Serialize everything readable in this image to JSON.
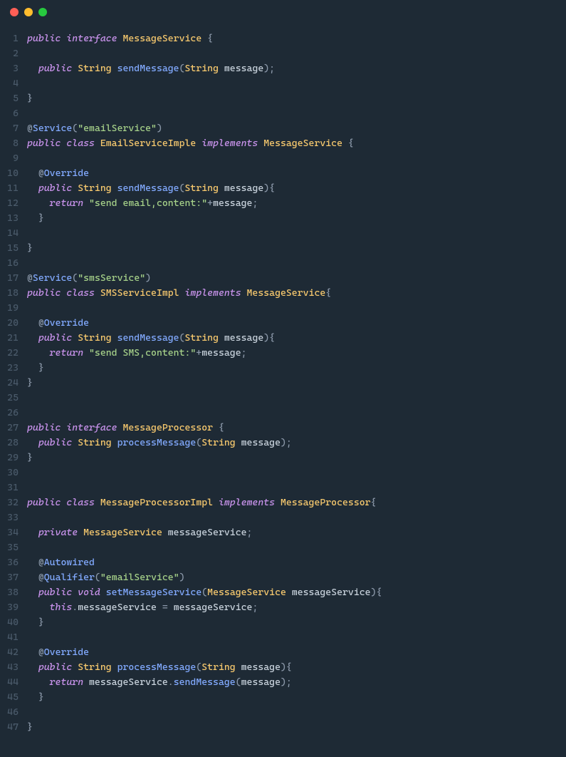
{
  "titlebar": {
    "dots": [
      "red",
      "yellow",
      "green"
    ]
  },
  "code": {
    "lines": [
      [
        {
          "t": "public ",
          "c": "kw"
        },
        {
          "t": "interface ",
          "c": "kw"
        },
        {
          "t": "MessageService",
          "c": "type"
        },
        {
          "t": " {",
          "c": "punct"
        }
      ],
      [],
      [
        {
          "t": "  ",
          "c": ""
        },
        {
          "t": "public ",
          "c": "kw"
        },
        {
          "t": "String ",
          "c": "type"
        },
        {
          "t": "sendMessage",
          "c": "fn"
        },
        {
          "t": "(",
          "c": "punct"
        },
        {
          "t": "String ",
          "c": "type"
        },
        {
          "t": "message",
          "c": "ident"
        },
        {
          "t": ");",
          "c": "punct"
        }
      ],
      [],
      [
        {
          "t": "}",
          "c": "punct"
        }
      ],
      [],
      [
        {
          "t": "@",
          "c": "punct"
        },
        {
          "t": "Service",
          "c": "annName"
        },
        {
          "t": "(",
          "c": "punct"
        },
        {
          "t": "\"emailService\"",
          "c": "str"
        },
        {
          "t": ")",
          "c": "punct"
        }
      ],
      [
        {
          "t": "public ",
          "c": "kw"
        },
        {
          "t": "class ",
          "c": "kw"
        },
        {
          "t": "EmailServiceImple ",
          "c": "type"
        },
        {
          "t": "implements ",
          "c": "kw"
        },
        {
          "t": "MessageService",
          "c": "type"
        },
        {
          "t": " {",
          "c": "punct"
        }
      ],
      [],
      [
        {
          "t": "  ",
          "c": ""
        },
        {
          "t": "@",
          "c": "punct"
        },
        {
          "t": "Override",
          "c": "annName"
        }
      ],
      [
        {
          "t": "  ",
          "c": ""
        },
        {
          "t": "public ",
          "c": "kw"
        },
        {
          "t": "String ",
          "c": "type"
        },
        {
          "t": "sendMessage",
          "c": "fn"
        },
        {
          "t": "(",
          "c": "punct"
        },
        {
          "t": "String ",
          "c": "type"
        },
        {
          "t": "message",
          "c": "ident"
        },
        {
          "t": "){",
          "c": "punct"
        }
      ],
      [
        {
          "t": "    ",
          "c": ""
        },
        {
          "t": "return ",
          "c": "kw"
        },
        {
          "t": "\"send email,content:\"",
          "c": "str"
        },
        {
          "t": "+",
          "c": "punct"
        },
        {
          "t": "message",
          "c": "ident"
        },
        {
          "t": ";",
          "c": "punct"
        }
      ],
      [
        {
          "t": "  ",
          "c": ""
        },
        {
          "t": "}",
          "c": "punct"
        }
      ],
      [],
      [
        {
          "t": "}",
          "c": "punct"
        }
      ],
      [],
      [
        {
          "t": "@",
          "c": "punct"
        },
        {
          "t": "Service",
          "c": "annName"
        },
        {
          "t": "(",
          "c": "punct"
        },
        {
          "t": "\"smsService\"",
          "c": "str"
        },
        {
          "t": ")",
          "c": "punct"
        }
      ],
      [
        {
          "t": "public ",
          "c": "kw"
        },
        {
          "t": "class ",
          "c": "kw"
        },
        {
          "t": "SMSServiceImpl ",
          "c": "type"
        },
        {
          "t": "implements ",
          "c": "kw"
        },
        {
          "t": "MessageService",
          "c": "type"
        },
        {
          "t": "{",
          "c": "punct"
        }
      ],
      [],
      [
        {
          "t": "  ",
          "c": ""
        },
        {
          "t": "@",
          "c": "punct"
        },
        {
          "t": "Override",
          "c": "annName"
        }
      ],
      [
        {
          "t": "  ",
          "c": ""
        },
        {
          "t": "public ",
          "c": "kw"
        },
        {
          "t": "String ",
          "c": "type"
        },
        {
          "t": "sendMessage",
          "c": "fn"
        },
        {
          "t": "(",
          "c": "punct"
        },
        {
          "t": "String ",
          "c": "type"
        },
        {
          "t": "message",
          "c": "ident"
        },
        {
          "t": "){",
          "c": "punct"
        }
      ],
      [
        {
          "t": "    ",
          "c": ""
        },
        {
          "t": "return ",
          "c": "kw"
        },
        {
          "t": "\"send SMS,content:\"",
          "c": "str"
        },
        {
          "t": "+",
          "c": "punct"
        },
        {
          "t": "message",
          "c": "ident"
        },
        {
          "t": ";",
          "c": "punct"
        }
      ],
      [
        {
          "t": "  ",
          "c": ""
        },
        {
          "t": "}",
          "c": "punct"
        }
      ],
      [
        {
          "t": "}",
          "c": "punct"
        }
      ],
      [],
      [],
      [
        {
          "t": "public ",
          "c": "kw"
        },
        {
          "t": "interface ",
          "c": "kw"
        },
        {
          "t": "MessageProcessor",
          "c": "type"
        },
        {
          "t": " {",
          "c": "punct"
        }
      ],
      [
        {
          "t": "  ",
          "c": ""
        },
        {
          "t": "public ",
          "c": "kw"
        },
        {
          "t": "String ",
          "c": "type"
        },
        {
          "t": "processMessage",
          "c": "fn"
        },
        {
          "t": "(",
          "c": "punct"
        },
        {
          "t": "String ",
          "c": "type"
        },
        {
          "t": "message",
          "c": "ident"
        },
        {
          "t": ");",
          "c": "punct"
        }
      ],
      [
        {
          "t": "}",
          "c": "punct"
        }
      ],
      [],
      [],
      [
        {
          "t": "public ",
          "c": "kw"
        },
        {
          "t": "class ",
          "c": "kw"
        },
        {
          "t": "MessageProcessorImpl ",
          "c": "type"
        },
        {
          "t": "implements ",
          "c": "kw"
        },
        {
          "t": "MessageProcessor",
          "c": "type"
        },
        {
          "t": "{",
          "c": "punct"
        }
      ],
      [],
      [
        {
          "t": "  ",
          "c": ""
        },
        {
          "t": "private ",
          "c": "kw"
        },
        {
          "t": "MessageService ",
          "c": "type"
        },
        {
          "t": "messageService",
          "c": "ident"
        },
        {
          "t": ";",
          "c": "punct"
        }
      ],
      [],
      [
        {
          "t": "  ",
          "c": ""
        },
        {
          "t": "@",
          "c": "punct"
        },
        {
          "t": "Autowired",
          "c": "annName"
        }
      ],
      [
        {
          "t": "  ",
          "c": ""
        },
        {
          "t": "@",
          "c": "punct"
        },
        {
          "t": "Qualifier",
          "c": "annName"
        },
        {
          "t": "(",
          "c": "punct"
        },
        {
          "t": "\"emailService\"",
          "c": "str"
        },
        {
          "t": ")",
          "c": "punct"
        }
      ],
      [
        {
          "t": "  ",
          "c": ""
        },
        {
          "t": "public ",
          "c": "kw"
        },
        {
          "t": "void ",
          "c": "kw"
        },
        {
          "t": "setMessageService",
          "c": "fn"
        },
        {
          "t": "(",
          "c": "punct"
        },
        {
          "t": "MessageService ",
          "c": "type"
        },
        {
          "t": "messageService",
          "c": "ident"
        },
        {
          "t": "){",
          "c": "punct"
        }
      ],
      [
        {
          "t": "    ",
          "c": ""
        },
        {
          "t": "this",
          "c": "kw"
        },
        {
          "t": ".",
          "c": "punct"
        },
        {
          "t": "messageService",
          "c": "ident"
        },
        {
          "t": " = ",
          "c": "punct"
        },
        {
          "t": "messageService",
          "c": "ident"
        },
        {
          "t": ";",
          "c": "punct"
        }
      ],
      [
        {
          "t": "  ",
          "c": ""
        },
        {
          "t": "}",
          "c": "punct"
        }
      ],
      [],
      [
        {
          "t": "  ",
          "c": ""
        },
        {
          "t": "@",
          "c": "punct"
        },
        {
          "t": "Override",
          "c": "annName"
        }
      ],
      [
        {
          "t": "  ",
          "c": ""
        },
        {
          "t": "public ",
          "c": "kw"
        },
        {
          "t": "String ",
          "c": "type"
        },
        {
          "t": "processMessage",
          "c": "fn"
        },
        {
          "t": "(",
          "c": "punct"
        },
        {
          "t": "String ",
          "c": "type"
        },
        {
          "t": "message",
          "c": "ident"
        },
        {
          "t": "){",
          "c": "punct"
        }
      ],
      [
        {
          "t": "    ",
          "c": ""
        },
        {
          "t": "return ",
          "c": "kw"
        },
        {
          "t": "messageService",
          "c": "ident"
        },
        {
          "t": ".",
          "c": "punct"
        },
        {
          "t": "sendMessage",
          "c": "fn"
        },
        {
          "t": "(",
          "c": "punct"
        },
        {
          "t": "message",
          "c": "ident"
        },
        {
          "t": ");",
          "c": "punct"
        }
      ],
      [
        {
          "t": "  ",
          "c": ""
        },
        {
          "t": "}",
          "c": "punct"
        }
      ],
      [],
      [
        {
          "t": "}",
          "c": "punct"
        }
      ]
    ]
  }
}
